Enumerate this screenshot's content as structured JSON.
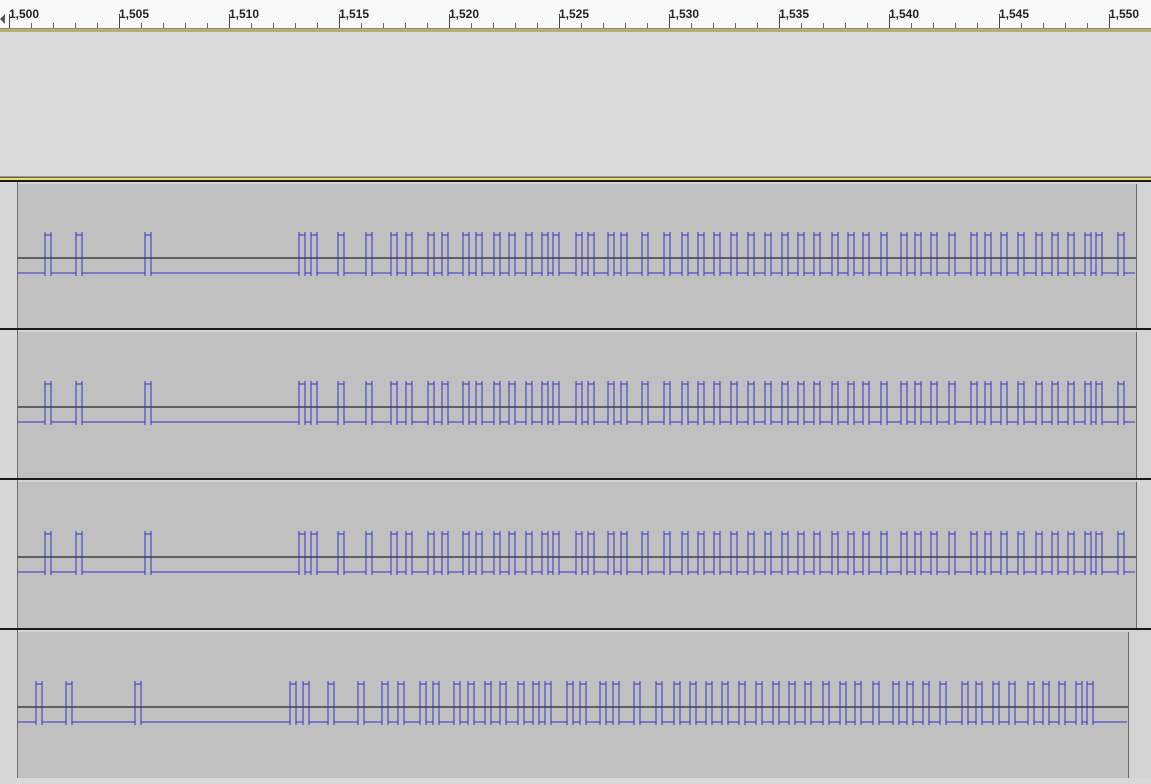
{
  "ruler": {
    "ticks": [
      "1,500",
      "1,505",
      "1,510",
      "1,515",
      "1,520",
      "1,525",
      "1,530",
      "1,535",
      "1,540",
      "1,545",
      "1,550"
    ]
  },
  "colors": {
    "waveform": "#3232cc",
    "center_line": "#000000",
    "track_background": "#c0c0c0",
    "selection_band": "#e8dc7a"
  },
  "tracks": [
    {
      "id": "track-1",
      "transitions": [
        27,
        33,
        58,
        64,
        127,
        133,
        281,
        287,
        293,
        299,
        320,
        326,
        348,
        354,
        373,
        379,
        388,
        394,
        410,
        416,
        424,
        430,
        445,
        451,
        458,
        464,
        476,
        482,
        491,
        497,
        508,
        514,
        524,
        530,
        535,
        541,
        558,
        564,
        570,
        576,
        590,
        596,
        603,
        609,
        624,
        630,
        646,
        652,
        664,
        670,
        680,
        686,
        696,
        702,
        713,
        719,
        730,
        736,
        747,
        753,
        764,
        770,
        780,
        786,
        796,
        802,
        814,
        820,
        830,
        836,
        845,
        851,
        863,
        869,
        883,
        889,
        897,
        903,
        913,
        919,
        931,
        937,
        953,
        959,
        967,
        973,
        983,
        989,
        1000,
        1006,
        1018,
        1024,
        1034,
        1040,
        1050,
        1056,
        1067,
        1073,
        1078,
        1084,
        1100,
        1106
      ],
      "start_level": "low"
    },
    {
      "id": "track-2",
      "transitions": [
        27,
        33,
        58,
        64,
        127,
        133,
        281,
        287,
        293,
        299,
        320,
        326,
        348,
        354,
        373,
        379,
        388,
        394,
        410,
        416,
        424,
        430,
        445,
        451,
        458,
        464,
        476,
        482,
        491,
        497,
        508,
        514,
        524,
        530,
        535,
        541,
        558,
        564,
        570,
        576,
        590,
        596,
        603,
        609,
        624,
        630,
        646,
        652,
        664,
        670,
        680,
        686,
        696,
        702,
        713,
        719,
        730,
        736,
        747,
        753,
        764,
        770,
        780,
        786,
        796,
        802,
        814,
        820,
        830,
        836,
        845,
        851,
        863,
        869,
        883,
        889,
        897,
        903,
        913,
        919,
        931,
        937,
        953,
        959,
        967,
        973,
        983,
        989,
        1000,
        1006,
        1018,
        1024,
        1034,
        1040,
        1050,
        1056,
        1067,
        1073,
        1078,
        1084,
        1100,
        1106
      ],
      "start_level": "low"
    },
    {
      "id": "track-3",
      "transitions": [
        27,
        33,
        58,
        64,
        127,
        133,
        281,
        287,
        293,
        299,
        320,
        326,
        348,
        354,
        373,
        379,
        388,
        394,
        410,
        416,
        424,
        430,
        445,
        451,
        458,
        464,
        476,
        482,
        491,
        497,
        508,
        514,
        524,
        530,
        535,
        541,
        558,
        564,
        570,
        576,
        590,
        596,
        603,
        609,
        624,
        630,
        646,
        652,
        664,
        670,
        680,
        686,
        696,
        702,
        713,
        719,
        730,
        736,
        747,
        753,
        764,
        770,
        780,
        786,
        796,
        802,
        814,
        820,
        830,
        836,
        845,
        851,
        863,
        869,
        883,
        889,
        897,
        903,
        913,
        919,
        931,
        937,
        953,
        959,
        967,
        973,
        983,
        989,
        1000,
        1006,
        1018,
        1024,
        1034,
        1040,
        1050,
        1056,
        1067,
        1073,
        1078,
        1084,
        1100,
        1106
      ],
      "start_level": "low"
    },
    {
      "id": "track-4",
      "transitions": [
        18,
        24,
        48,
        54,
        117,
        123,
        272,
        278,
        285,
        291,
        310,
        316,
        340,
        346,
        364,
        370,
        380,
        386,
        402,
        408,
        415,
        421,
        436,
        442,
        450,
        456,
        467,
        473,
        482,
        488,
        500,
        506,
        515,
        521,
        527,
        533,
        549,
        555,
        562,
        568,
        582,
        588,
        595,
        601,
        616,
        622,
        638,
        644,
        656,
        662,
        672,
        678,
        688,
        694,
        704,
        710,
        721,
        727,
        738,
        744,
        755,
        761,
        771,
        777,
        787,
        793,
        805,
        811,
        822,
        828,
        837,
        843,
        855,
        861,
        875,
        881,
        889,
        895,
        905,
        911,
        922,
        928,
        944,
        950,
        958,
        964,
        975,
        981,
        991,
        997,
        1010,
        1016,
        1025,
        1031,
        1041,
        1047,
        1058,
        1064,
        1069,
        1075
      ],
      "start_level": "low"
    }
  ]
}
